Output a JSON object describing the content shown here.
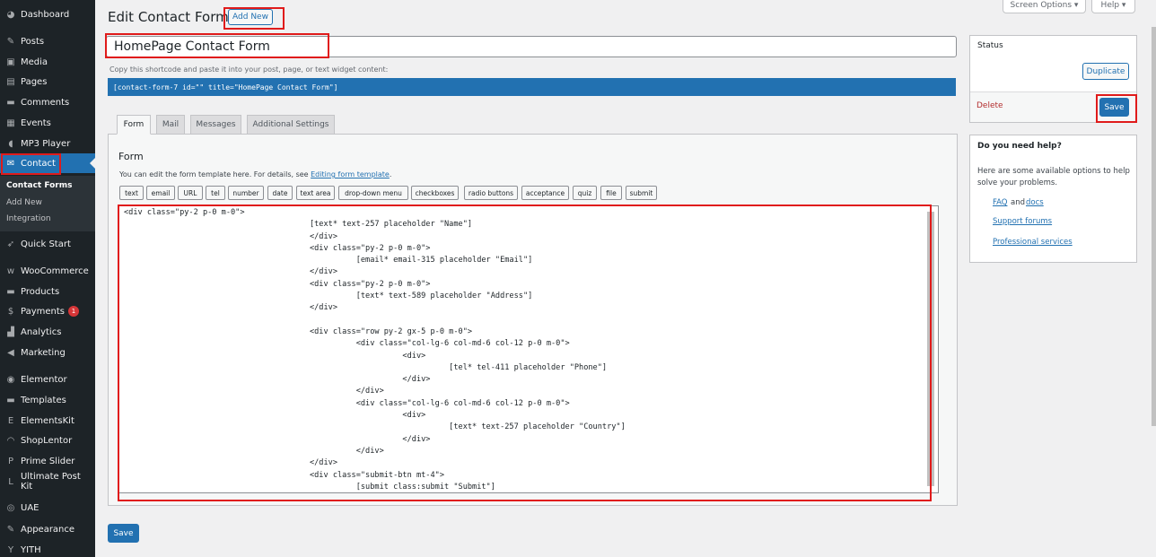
{
  "sidebar": {
    "items": [
      {
        "label": "Dashboard",
        "icon": "dashboard-icon",
        "glyph": "◕"
      },
      {
        "label": "Posts",
        "icon": "pin-icon",
        "glyph": "✎"
      },
      {
        "label": "Media",
        "icon": "media-icon",
        "glyph": "▣"
      },
      {
        "label": "Pages",
        "icon": "pages-icon",
        "glyph": "▤"
      },
      {
        "label": "Comments",
        "icon": "comments-icon",
        "glyph": "▬"
      },
      {
        "label": "Events",
        "icon": "calendar-icon",
        "glyph": "▦"
      },
      {
        "label": "MP3 Player",
        "icon": "audio-icon",
        "glyph": "◖"
      },
      {
        "label": "Contact",
        "icon": "mail-icon",
        "glyph": "✉"
      },
      {
        "label": "Quick Start",
        "icon": "rocket-icon",
        "glyph": "➶"
      },
      {
        "label": "WooCommerce",
        "icon": "woo-icon",
        "glyph": "w"
      },
      {
        "label": "Products",
        "icon": "archive-icon",
        "glyph": "▬"
      },
      {
        "label": "Payments",
        "icon": "dollar-icon",
        "glyph": "$",
        "badge": "1"
      },
      {
        "label": "Analytics",
        "icon": "analytics-icon",
        "glyph": "▟"
      },
      {
        "label": "Marketing",
        "icon": "megaphone-icon",
        "glyph": "◀"
      },
      {
        "label": "Elementor",
        "icon": "elementor-icon",
        "glyph": "◉"
      },
      {
        "label": "Templates",
        "icon": "folder-icon",
        "glyph": "▬"
      },
      {
        "label": "ElementsKit",
        "icon": "elementskit-icon",
        "glyph": "E"
      },
      {
        "label": "ShopLentor",
        "icon": "shoplentor-icon",
        "glyph": "◠"
      },
      {
        "label": "Prime Slider",
        "icon": "slider-icon",
        "glyph": "P"
      },
      {
        "label": "Ultimate Post Kit",
        "icon": "postkit-icon",
        "glyph": "L"
      },
      {
        "label": "UAE",
        "icon": "uae-icon",
        "glyph": "◎"
      },
      {
        "label": "Appearance",
        "icon": "brush-icon",
        "glyph": "✎"
      },
      {
        "label": "YITH",
        "icon": "yith-icon",
        "glyph": "Y"
      }
    ],
    "submenu": [
      "Contact Forms",
      "Add New",
      "Integration"
    ]
  },
  "header": {
    "title": "Edit Contact Form",
    "add_new": "Add New",
    "screen_options": "Screen Options ▾",
    "help": "Help ▾"
  },
  "form": {
    "title_value": "HomePage Contact Form",
    "shortcode_hint": "Copy this shortcode and paste it into your post, page, or text widget content:",
    "shortcode": "[contact-form-7 id=\"\" title=\"HomePage Contact Form\"]",
    "tabs": [
      "Form",
      "Mail",
      "Messages",
      "Additional Settings"
    ],
    "panel_heading": "Form",
    "desc_prefix": "You can edit the form template here. For details, see ",
    "desc_link": "Editing form template",
    "desc_suffix": ".",
    "tag_buttons": [
      "text",
      "email",
      "URL",
      "tel",
      "number",
      "date",
      "text area",
      "drop-down menu",
      "checkboxes",
      "radio buttons",
      "acceptance",
      "quiz",
      "file",
      "submit"
    ],
    "code": "<div class=\"py-2 p-0 m-0\">\n                                        [text* text-257 placeholder \"Name\"]\n                                        </div>\n                                        <div class=\"py-2 p-0 m-0\">\n                                                  [email* email-315 placeholder \"Email\"]\n                                        </div>\n                                        <div class=\"py-2 p-0 m-0\">\n                                                  [text* text-589 placeholder \"Address\"]\n                                        </div>\n\n                                        <div class=\"row py-2 gx-5 p-0 m-0\">\n                                                  <div class=\"col-lg-6 col-md-6 col-12 p-0 m-0\">\n                                                            <div>\n                                                                      [tel* tel-411 placeholder \"Phone\"]\n                                                            </div>\n                                                  </div>\n                                                  <div class=\"col-lg-6 col-md-6 col-12 p-0 m-0\">\n                                                            <div>\n                                                                      [text* text-257 placeholder \"Country\"]\n                                                            </div>\n                                                  </div>\n                                        </div>\n                                        <div class=\"submit-btn mt-4\">\n                                                  [submit class:submit \"Submit\"]",
    "save": "Save"
  },
  "status": {
    "title": "Status",
    "duplicate": "Duplicate",
    "delete": "Delete",
    "save": "Save"
  },
  "help": {
    "title": "Do you need help?",
    "text": "Here are some available options to help solve your problems.",
    "faq": "FAQ",
    "and": "and",
    "docs": "docs",
    "forums": "Support forums",
    "services": "Professional services"
  },
  "colors": {
    "sidebar": "#1d2327",
    "accent": "#2271b1",
    "highlight": "#e01b1b"
  }
}
